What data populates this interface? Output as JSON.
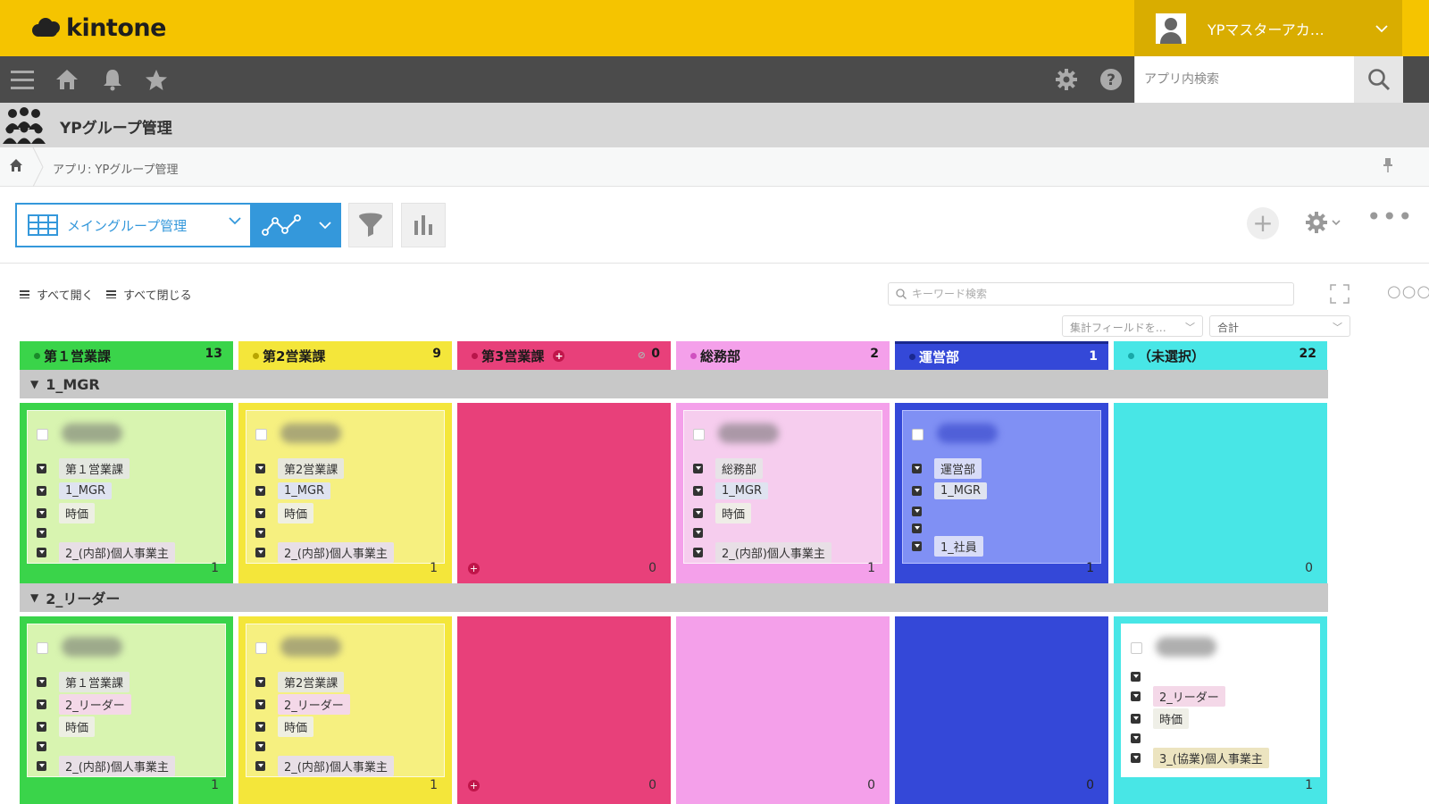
{
  "header": {
    "logo_text": "kintone",
    "user_name": "YPマスターアカ…",
    "brand_color": "#f5c400"
  },
  "nav": {
    "search_placeholder": "アプリ内検索",
    "icons": [
      "menu-icon",
      "home-icon",
      "bell-icon",
      "star-icon",
      "gear-icon",
      "help-icon",
      "search-icon"
    ]
  },
  "app": {
    "title": "YPグループ管理"
  },
  "breadcrumb": {
    "text": "アプリ: YPグループ管理"
  },
  "toolbar": {
    "view_label": "メイングループ管理"
  },
  "kanban": {
    "expand_all": "すべて開く",
    "collapse_all": "すべて閉じる",
    "keyword_placeholder": "キーワード検索",
    "agg_field_placeholder": "集計フィールドを…",
    "agg_type": "合計",
    "columns": [
      {
        "title": "第１営業課",
        "count": "13",
        "color": "#3ad44a",
        "dot": "#1a8a2a",
        "text": "#1a1a1a"
      },
      {
        "title": "第2営業課",
        "count": "9",
        "color": "#f4e63a",
        "dot": "#b8a500",
        "text": "#1a1a1a"
      },
      {
        "title": "第3営業課",
        "count": "0",
        "color": "#e8407a",
        "dot": "#b8154a",
        "text": "#1a1a1a"
      },
      {
        "title": "総務部",
        "count": "2",
        "color": "#f4a0ea",
        "dot": "#d050c0",
        "text": "#1a1a1a"
      },
      {
        "title": "運営部",
        "count": "1",
        "color": "#3448d8",
        "dot": "#1a2890",
        "text": "#ffffff"
      },
      {
        "title": "（未選択）",
        "count": "22",
        "color": "#48e6e6",
        "dot": "#18a8a8",
        "text": "#1a1a1a"
      }
    ],
    "lanes": [
      {
        "title": "1_MGR",
        "cell_counts": [
          "1",
          "1",
          "0",
          "1",
          "1",
          "0"
        ],
        "cards": [
          {
            "fields": [
              "第１営業課",
              "1_MGR",
              "時価",
              "",
              "2_(内部)個人事業主"
            ]
          },
          {
            "fields": [
              "第2営業課",
              "1_MGR",
              "時価",
              "",
              "2_(内部)個人事業主"
            ]
          },
          null,
          {
            "fields": [
              "総務部",
              "1_MGR",
              "時価",
              "",
              "2_(内部)個人事業主"
            ]
          },
          {
            "fields": [
              "運営部",
              "1_MGR",
              "",
              "",
              "1_社員"
            ]
          },
          null
        ]
      },
      {
        "title": "2_リーダー",
        "cell_counts": [
          "1",
          "1",
          "0",
          "0",
          "0",
          "1"
        ],
        "cards": [
          {
            "fields": [
              "第１営業課",
              "2_リーダー",
              "時価",
              "",
              "2_(内部)個人事業主"
            ]
          },
          {
            "fields": [
              "第2営業課",
              "2_リーダー",
              "時価",
              "",
              "2_(内部)個人事業主"
            ]
          },
          null,
          null,
          null,
          {
            "fields": [
              "",
              "2_リーダー",
              "時価",
              "",
              "3_(協業)個人事業主"
            ]
          }
        ]
      }
    ]
  }
}
